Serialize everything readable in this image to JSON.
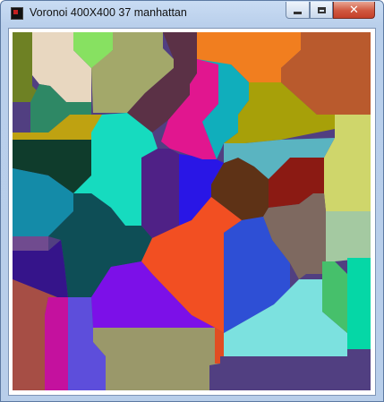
{
  "window": {
    "title": "Voronoi 400X400 37 manhattan",
    "minimize_glyph": "minimize-icon",
    "maximize_glyph": "maximize-icon",
    "close_glyph": "close-icon",
    "close_label": "✕"
  },
  "diagram": {
    "site_count": 37,
    "metric": "manhattan",
    "size": "400X400",
    "colors": [
      "#6e8124",
      "#e8d7c0",
      "#87e161",
      "#a3a86a",
      "#5b3146",
      "#f17e1f",
      "#b95a2d",
      "#2e8865",
      "#bfa211",
      "#0f3c2c",
      "#16dbbf",
      "#e1168f",
      "#10aebc",
      "#a7a009",
      "#cfd66b",
      "#148ba8",
      "#0e4e56",
      "#4f2186",
      "#2916e6",
      "#5e3216",
      "#8b1a13",
      "#5ab4c1",
      "#7e6960",
      "#a4c9a1",
      "#704b8f",
      "#35148a",
      "#f24f22",
      "#2e4fd5",
      "#7c10e8",
      "#a64e45",
      "#c4119e",
      "#5d4edb",
      "#9a986a",
      "#7ce1df",
      "#513f81",
      "#46c06b",
      "#05d7a6"
    ]
  }
}
